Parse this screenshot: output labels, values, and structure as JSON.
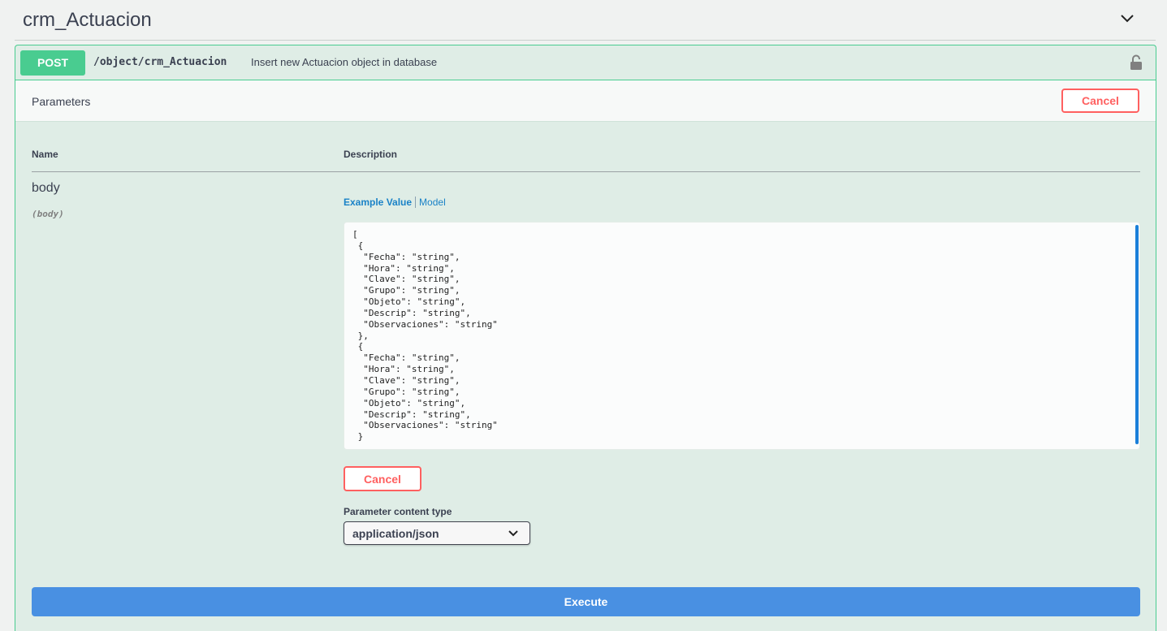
{
  "tag": {
    "title": "crm_Actuacion",
    "chevron_icon": "chevron-down-icon"
  },
  "operation": {
    "method": "POST",
    "path": "/object/crm_Actuacion",
    "description": "Insert new Actuacion object in database",
    "lock_icon": "unlocked-lock-icon",
    "method_color": "#49cc90"
  },
  "parameters": {
    "title": "Parameters",
    "cancel_label": "Cancel",
    "headers": {
      "name": "Name",
      "description": "Description"
    },
    "param": {
      "name": "body",
      "in": "(body)"
    },
    "tabs": {
      "example": "Example Value",
      "model": "Model"
    },
    "body_lines": [
      "[",
      " {",
      "  \"Fecha\": \"string\",",
      "  \"Hora\": \"string\",",
      "  \"Clave\": \"string\",",
      "  \"Grupo\": \"string\",",
      "  \"Objeto\": \"string\",",
      "  \"Descrip\": \"string\",",
      "  \"Observaciones\": \"string\"",
      " },",
      " {",
      "  \"Fecha\": \"string\",",
      "  \"Hora\": \"string\",",
      "  \"Clave\": \"string\",",
      "  \"Grupo\": \"string\",",
      "  \"Objeto\": \"string\",",
      "  \"Descrip\": \"string\",",
      "  \"Observaciones\": \"string\"",
      " }"
    ],
    "cancel_bottom_label": "Cancel",
    "content_type_label": "Parameter content type",
    "content_type_value": "application/json"
  },
  "execute_label": "Execute",
  "colors": {
    "cancel": "#ff6060",
    "execute": "#4990e2",
    "link": "#1a82c7"
  }
}
